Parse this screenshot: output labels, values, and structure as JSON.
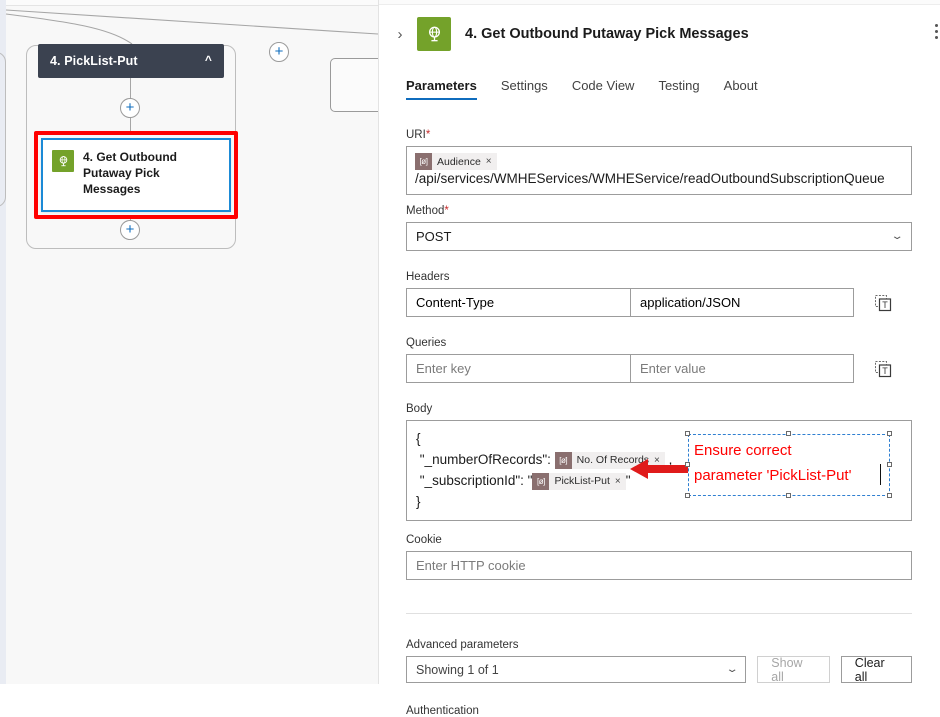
{
  "canvas": {
    "scope": {
      "title": "4. PickList-Put",
      "collapse_icon": "chevron-up-icon"
    },
    "selected_node": {
      "label": "4. Get Outbound Putaway Pick Messages",
      "icon": "http-globe-icon",
      "icon_color": "#74a22a",
      "highlight_color": "#ff0000",
      "selection_color": "#1b8ad6"
    },
    "add_buttons": [
      "+",
      "+",
      "+"
    ]
  },
  "panel": {
    "expand_icon": "chevron-right-icon",
    "icon": "http-globe-icon",
    "title": "4. Get Outbound Putaway Pick Messages",
    "more_icon": "more-vertical-icon",
    "tabs": [
      {
        "label": "Parameters",
        "active": true
      },
      {
        "label": "Settings",
        "active": false
      },
      {
        "label": "Code View",
        "active": false
      },
      {
        "label": "Testing",
        "active": false
      },
      {
        "label": "About",
        "active": false
      }
    ],
    "accent_color": "#0f6cbd"
  },
  "form": {
    "uri": {
      "label": "URI",
      "required": "*",
      "token": {
        "icon": "[ø]",
        "text": "Audience",
        "remove": "×"
      },
      "path": "/api/services/WMHEServices/WMHEService/readOutboundSubscriptionQueue"
    },
    "method": {
      "label": "Method",
      "required": "*",
      "value": "POST",
      "chevron": "chevron-down-icon"
    },
    "headers": {
      "label": "Headers",
      "key": "Content-Type",
      "value": "application/JSON",
      "text_mode_icon": "switch-to-text-mode-icon"
    },
    "queries": {
      "label": "Queries",
      "key_placeholder": "Enter key",
      "value_placeholder": "Enter value",
      "text_mode_icon": "switch-to-text-mode-icon"
    },
    "body": {
      "label": "Body",
      "line1": "{",
      "line2_key": "\"_numberOfRecords\":",
      "line2_token": {
        "icon": "[ø]",
        "text": "No. Of Records",
        "remove": "×"
      },
      "line2_tail": ",",
      "line3_key": "\"_subscriptionId\": \"",
      "line3_token": {
        "icon": "[ø]",
        "text": "PickList-Put",
        "remove": "×"
      },
      "line3_tail": "\"",
      "line4": "}"
    },
    "cookie": {
      "label": "Cookie",
      "placeholder": "Enter HTTP cookie"
    },
    "advanced": {
      "label": "Advanced parameters",
      "value": "Showing 1 of 1",
      "chevron": "chevron-down-icon",
      "show_all": "Show all",
      "show_all_disabled": true,
      "clear_all": "Clear all"
    },
    "authentication": {
      "label": "Authentication"
    }
  },
  "annotation": {
    "text": "Ensure correct\nparameter 'PickList-Put'",
    "text_color": "#ff0000",
    "border_color": "#2f7fd1",
    "arrow_color": "#e01b1b",
    "arrow_name": "red-left-arrow"
  }
}
